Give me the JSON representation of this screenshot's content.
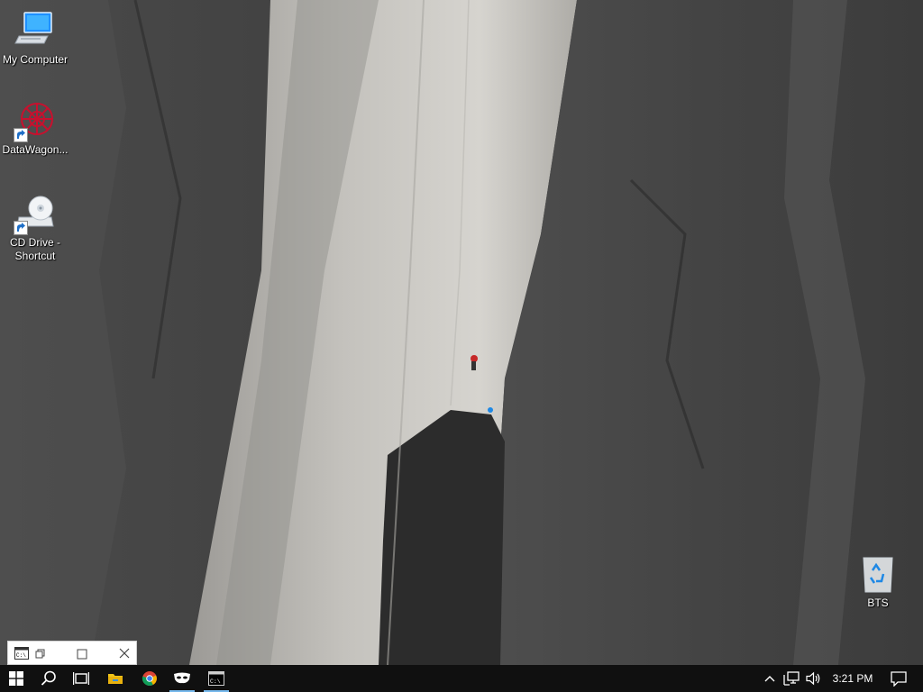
{
  "desktop": {
    "icons": [
      {
        "label": "My Computer",
        "icon": "computer-icon"
      },
      {
        "label": "DataWagon...",
        "icon": "datawagon-logo-icon"
      },
      {
        "label": "CD Drive - Shortcut",
        "icon": "cd-drive-icon"
      },
      {
        "label": "BTS",
        "icon": "recycle-bin-icon"
      }
    ]
  },
  "minimized_window": {
    "icon": "cmd-icon",
    "controls": [
      "restore-icon",
      "maximize-icon",
      "close-icon"
    ]
  },
  "taskbar": {
    "buttons": [
      {
        "name": "start",
        "icon": "windows-logo-icon"
      },
      {
        "name": "search",
        "icon": "search-icon"
      },
      {
        "name": "task-view",
        "icon": "task-view-icon"
      },
      {
        "name": "file-explorer",
        "icon": "folder-icon"
      },
      {
        "name": "chrome",
        "icon": "chrome-icon"
      },
      {
        "name": "app-mask",
        "icon": "mask-icon"
      },
      {
        "name": "command-prompt",
        "icon": "cmd-icon"
      }
    ],
    "tray": {
      "chevron": "chevron-up-icon",
      "network": "network-icon",
      "volume": "volume-icon",
      "clock": "3:21 PM",
      "notifications": "action-center-icon"
    }
  },
  "colors": {
    "taskbar_bg": "#101010",
    "active_indicator": "#76b9ed",
    "accent_red": "#c8102e"
  }
}
